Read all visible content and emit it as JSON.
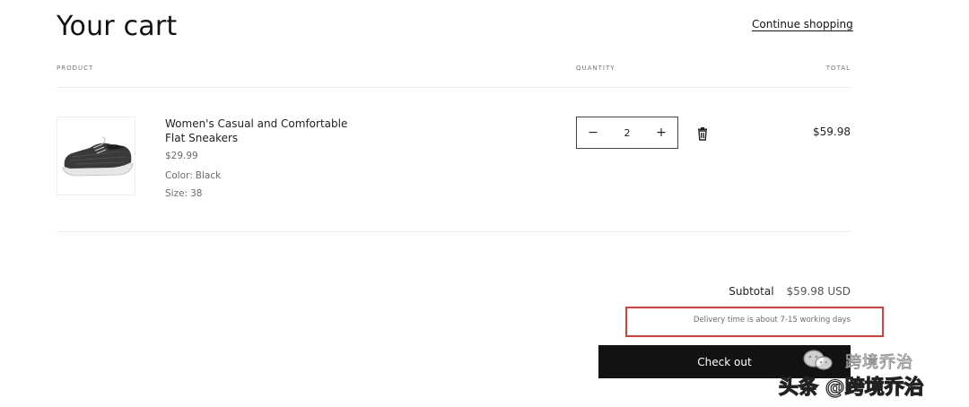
{
  "header": {
    "title": "Your cart",
    "continue_link": "Continue shopping"
  },
  "columns": {
    "product": "PRODUCT",
    "quantity": "QUANTITY",
    "total": "TOTAL"
  },
  "item": {
    "name": "Women's Casual and Comfortable Flat Sneakers",
    "price": "$29.99",
    "color_label": "Color:",
    "color_value": "Black",
    "size_label": "Size:",
    "size_value": "38",
    "quantity": "2",
    "decrease_symbol": "−",
    "increase_symbol": "+",
    "line_total": "$59.98",
    "image_icon": "sneaker-image",
    "remove_icon": "trash-icon"
  },
  "summary": {
    "subtotal_label": "Subtotal",
    "subtotal_value": "$59.98 USD",
    "delivery_note": "Delivery time is about 7-15 working days",
    "checkout_label": "Check out"
  },
  "watermark": {
    "top_text": "跨境乔治",
    "bottom_text": "头条 @跨境乔治"
  },
  "colors": {
    "text": "#121212",
    "muted": "#6b6b6b",
    "button_bg": "#121212",
    "highlight_border": "#e53935"
  }
}
